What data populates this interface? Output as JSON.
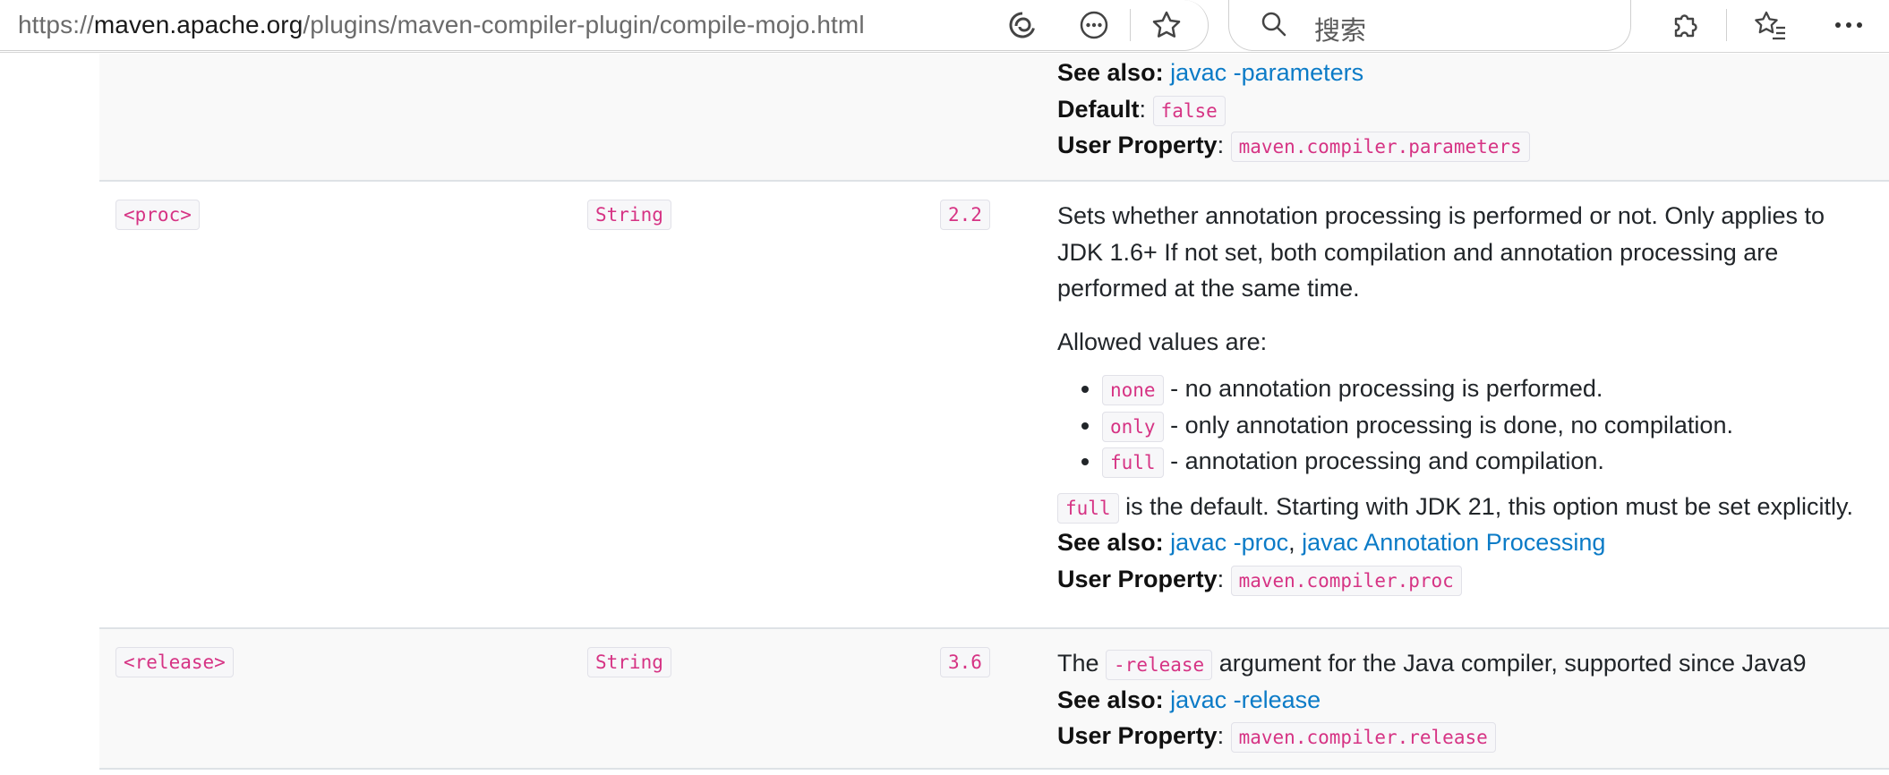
{
  "browser": {
    "url_prefix": "https://",
    "url_host": "maven.apache.org",
    "url_path": "/plugins/maven-compiler-plugin/compile-mojo.html",
    "search_placeholder": "搜索"
  },
  "labels": {
    "see_also": "See also:",
    "default": "Default",
    "user_property": "User Property",
    "colon": ":"
  },
  "rows": {
    "parameters": {
      "see_also_link": "javac -parameters",
      "default_value": "false",
      "user_property": "maven.compiler.parameters"
    },
    "proc": {
      "name": "<proc>",
      "type": "String",
      "since": "2.2",
      "desc_line1": "Sets whether annotation processing is performed or not. Only applies to",
      "desc_line2": "JDK 1.6+ If not set, both compilation and annotation processing are",
      "desc_line3": "performed at the same time.",
      "allowed_intro": "Allowed values are:",
      "values": [
        {
          "code": "none",
          "text": " - no annotation processing is performed."
        },
        {
          "code": "only",
          "text": " - only annotation processing is done, no compilation."
        },
        {
          "code": "full",
          "text": " - annotation processing and compilation."
        }
      ],
      "default_code": "full",
      "default_text": " is the default. Starting with JDK 21, this option must be set explicitly.",
      "see_also_link1": "javac -proc",
      "see_also_sep": ", ",
      "see_also_link2": "javac Annotation Processing",
      "user_property": "maven.compiler.proc"
    },
    "release": {
      "name": "<release>",
      "type": "String",
      "since": "3.6",
      "desc_before": "The ",
      "desc_code": "-release",
      "desc_after": " argument for the Java compiler, supported since Java9",
      "see_also_link": "javac -release",
      "user_property": "maven.compiler.release"
    }
  }
}
